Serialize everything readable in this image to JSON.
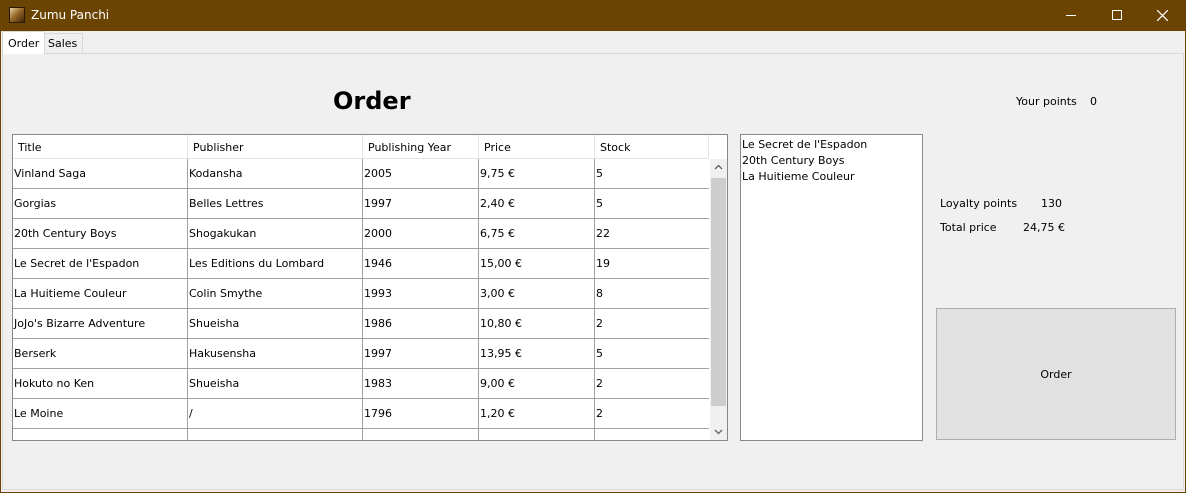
{
  "window": {
    "title": "Zumu Panchi",
    "controls": {
      "minimize": "minimize-icon",
      "maximize": "maximize-icon",
      "close": "close-icon"
    }
  },
  "tabs": [
    {
      "label": "Order",
      "selected": true
    },
    {
      "label": "Sales",
      "selected": false
    }
  ],
  "order": {
    "title": "Order",
    "your_points_label": "Your points",
    "your_points_value": "0",
    "table": {
      "columns": [
        "Title",
        "Publisher",
        "Publishing Year",
        "Price",
        "Stock"
      ],
      "rows": [
        [
          "Vinland Saga",
          "Kodansha",
          "2005",
          "9,75 €",
          "5"
        ],
        [
          "Gorgias",
          "Belles Lettres",
          "1997",
          "2,40 €",
          "5"
        ],
        [
          "20th Century Boys",
          "Shogakukan",
          "2000",
          "6,75 €",
          "22"
        ],
        [
          "Le Secret de l'Espadon",
          "Les Editions du Lombard",
          "1946",
          "15,00 €",
          "19"
        ],
        [
          "La Huitieme Couleur",
          "Colin Smythe",
          "1993",
          "3,00 €",
          "8"
        ],
        [
          "JoJo's Bizarre Adventure",
          "Shueisha",
          "1986",
          "10,80 €",
          "2"
        ],
        [
          "Berserk",
          "Hakusensha",
          "1997",
          "13,95 €",
          "5"
        ],
        [
          "Hokuto no Ken",
          "Shueisha",
          "1983",
          "9,00 €",
          "2"
        ],
        [
          "Le Moine",
          "/",
          "1796",
          "1,20 €",
          "2"
        ]
      ]
    },
    "cart_items": [
      "Le Secret de l'Espadon",
      "20th Century Boys",
      "La Huitieme Couleur"
    ],
    "loyalty_points_label": "Loyalty points",
    "loyalty_points_value": "130",
    "total_price_label": "Total price",
    "total_price_value": "24,75 €",
    "order_button_label": "Order"
  }
}
